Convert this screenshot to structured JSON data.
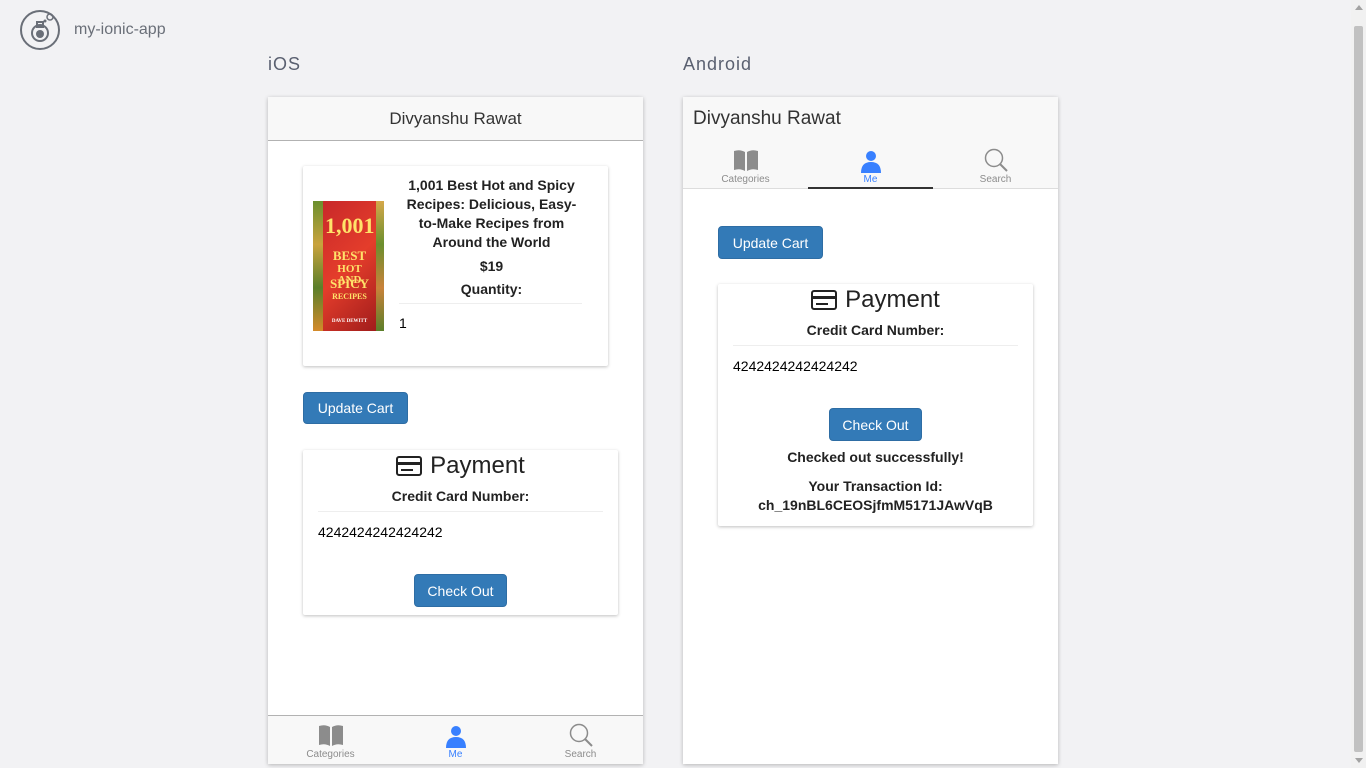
{
  "app": {
    "name": "my-ionic-app"
  },
  "platforms": {
    "ios": "iOS",
    "android": "Android"
  },
  "header": {
    "title": "Divyanshu Rawat"
  },
  "book": {
    "title": "1,001 Best Hot and Spicy Recipes: Delicious, Easy-to-Make Recipes from Around the World",
    "price": "$19",
    "quantity_label": "Quantity:",
    "quantity_value": "1",
    "cover_lines": [
      "1,001",
      "BEST",
      "HOT AND",
      "SPICY",
      "RECIPES",
      "DAVE DEWITT"
    ]
  },
  "cart": {
    "update_label": "Update Cart"
  },
  "payment": {
    "title": "Payment",
    "icon": "credit-card-icon",
    "cc_label": "Credit Card Number:",
    "cc_value": "4242424242424242",
    "checkout_label": "Check Out",
    "success_message": "Checked out successfully!",
    "transaction_label": "Your Transaction Id:",
    "transaction_id": "ch_19nBL6CEOSjfmM5171JAwVqB"
  },
  "tabs": [
    {
      "label": "Categories",
      "icon": "book-icon",
      "active": false
    },
    {
      "label": "Me",
      "icon": "person-icon",
      "active": true
    },
    {
      "label": "Search",
      "icon": "search-icon",
      "active": false
    }
  ],
  "colors": {
    "primary": "#337ab7",
    "active_tab": "#3880ff",
    "background": "#f2f2f4"
  }
}
